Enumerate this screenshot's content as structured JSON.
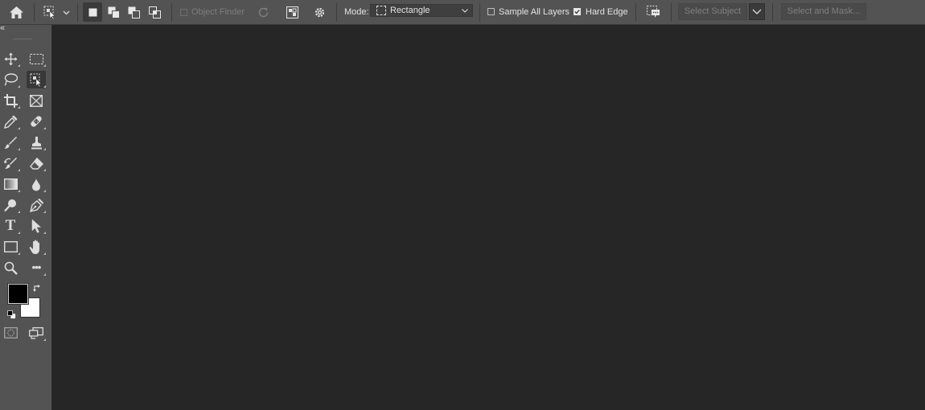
{
  "options_bar": {
    "object_finder_label": "Object Finder",
    "mode_label": "Mode:",
    "mode_value": "Rectangle",
    "sample_all_layers_label": "Sample All Layers",
    "sample_all_layers_checked": false,
    "hard_edge_label": "Hard Edge",
    "hard_edge_checked": true,
    "select_subject_label": "Select Subject",
    "select_and_mask_label": "Select and Mask..."
  },
  "toolbar": {
    "collapse_glyph": "«",
    "tools": [
      {
        "left": "move-tool",
        "right": "rectangular-marquee-tool"
      },
      {
        "left": "lasso-tool",
        "right": "object-selection-tool",
        "active": "right"
      },
      {
        "left": "crop-tool",
        "right": "frame-tool"
      },
      {
        "left": "eyedropper-tool",
        "right": "healing-brush-tool"
      },
      {
        "left": "brush-tool",
        "right": "clone-stamp-tool"
      },
      {
        "left": "history-brush-tool",
        "right": "eraser-tool"
      },
      {
        "left": "gradient-tool",
        "right": "blur-tool"
      },
      {
        "left": "dodge-tool",
        "right": "pen-tool"
      },
      {
        "left": "type-tool",
        "right": "path-selection-tool"
      },
      {
        "left": "rectangle-tool",
        "right": "hand-tool"
      },
      {
        "left": "zoom-tool",
        "right": "edit-toolbar"
      }
    ],
    "type_glyph": "T",
    "more_glyph": "•••",
    "foreground_color": "#000000",
    "background_color": "#ffffff"
  },
  "colors": {
    "panel": "#535353",
    "canvas": "#262626"
  }
}
